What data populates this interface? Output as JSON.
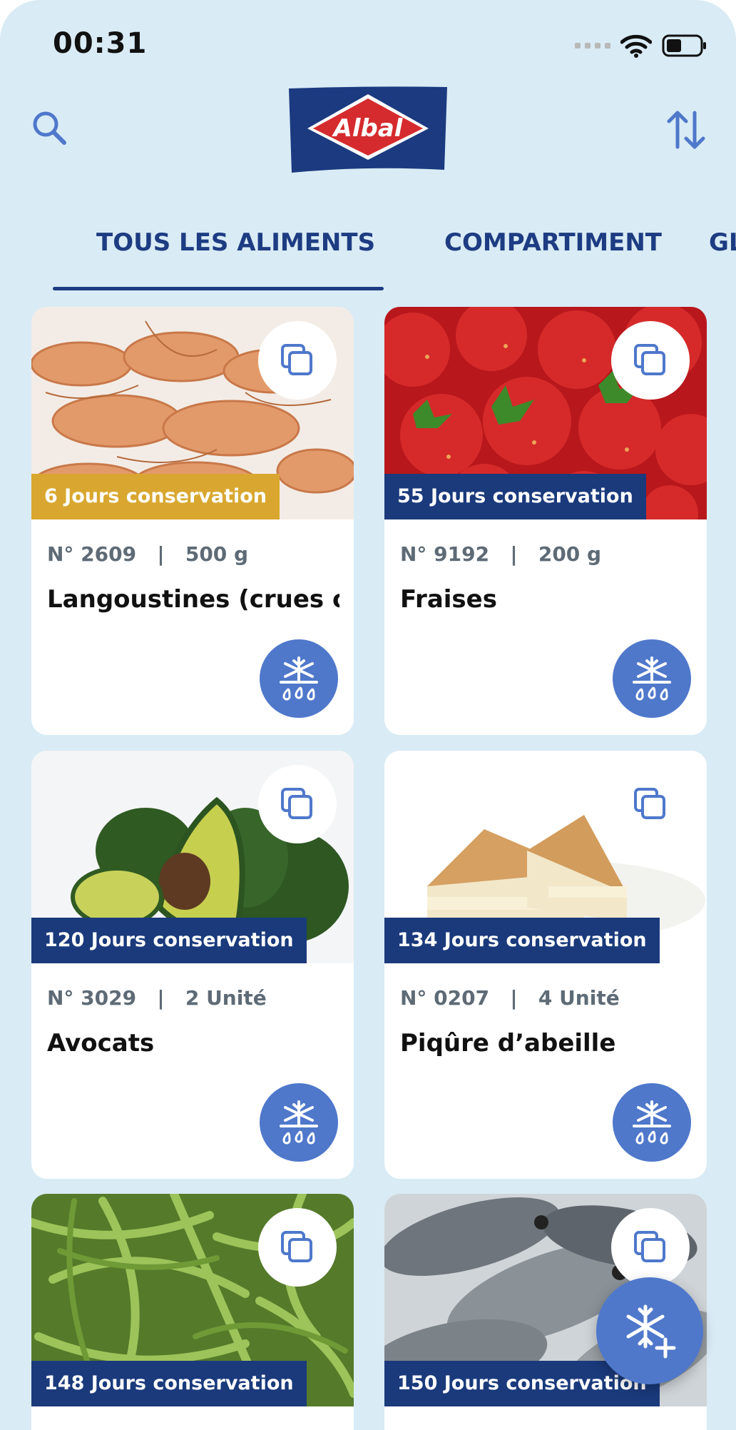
{
  "status_bar": {
    "time": "00:31"
  },
  "header": {
    "logo_text": "Albal",
    "search_icon": "search-icon",
    "sort_icon": "sort-arrows-icon"
  },
  "tabs": [
    {
      "label": "TOUS LES ALIMENTS",
      "active": true
    },
    {
      "label": "COMPARTIMENT",
      "active": false
    },
    {
      "label": "GL",
      "active": false
    }
  ],
  "colors": {
    "background": "#d9ebf5",
    "navy": "#1d3c82",
    "accent_blue": "#4f78cb",
    "badge_gold": "#d9a72f",
    "badge_navy": "#1a3a7c"
  },
  "items": [
    {
      "badge": "6 Jours conservation",
      "badge_color": "#d9a72f",
      "number": "N° 2609",
      "quantity": "500 g",
      "name": "Langoustines (crues o...",
      "image": "shrimp"
    },
    {
      "badge": "55 Jours conservation",
      "badge_color": "#1a3a7c",
      "number": "N° 9192",
      "quantity": "200 g",
      "name": "Fraises",
      "image": "strawberries"
    },
    {
      "badge": "120 Jours conservation",
      "badge_color": "#1a3a7c",
      "number": "N° 3029",
      "quantity": "2 Unité",
      "name": "Avocats",
      "image": "avocados"
    },
    {
      "badge": "134 Jours conservation",
      "badge_color": "#1a3a7c",
      "number": "N° 0207",
      "quantity": "4 Unité",
      "name": "Piqûre d’abeille",
      "image": "cake"
    },
    {
      "badge": "148 Jours conservation",
      "badge_color": "#1a3a7c",
      "number": "",
      "quantity": "",
      "name": "",
      "image": "green-beans"
    },
    {
      "badge": "150 Jours conservation",
      "badge_color": "#1a3a7c",
      "number": "",
      "quantity": "",
      "name": "",
      "image": "fish"
    }
  ],
  "fab": {
    "icon": "snowflake-plus-icon"
  }
}
